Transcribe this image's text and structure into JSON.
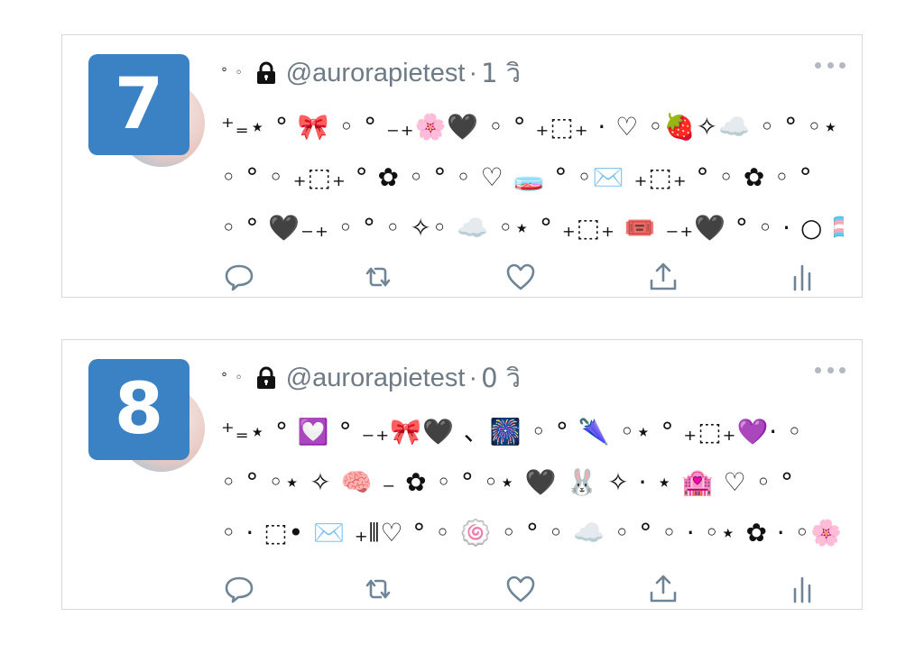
{
  "tweets": [
    {
      "rank": "7",
      "handle": "@aurorapietest",
      "separator": "·",
      "time": "1 วิ",
      "lines": [
        "⁺₌⋆ ° 🎀 ◦ ° ₋₊🌸🖤 ◦ ° ₊⬚₊ · ♡ ◦🍓✧☁️ ◦ ° ◦⋆",
        "◦ ° ◦ ₊⬚₊ ° ✿ ◦ ° ◦ ♡ 🧫 ° ◦✉️ ₊⬚₊ ° ◦ ✿ ◦ °",
        "◦ ° 🖤₋₊ ◦ ° ◦ ✧◦ ☁️ ◦⋆ ° ₊⬚₊ 🎟️ ₋₊🖤 ° ◦ · ○ 🏳️‍⚧️"
      ]
    },
    {
      "rank": "8",
      "handle": "@aurorapietest",
      "separator": "·",
      "time": "0 วิ",
      "lines": [
        "⁺₌⋆ ° 💟 ° ₋₊🎀🖤 、🎆 ◦ ° 🌂 ◦⋆ ° ₊⬚₊💜· ◦",
        "◦ ° ◦⋆ ✧ 🧠 ₋ ✿ ◦ ° ◦⋆ 🖤 🐰 ✧ · ⋆ 🏩 ♡ ◦ °",
        "◦ · ⬚• ✉️ ₊⫴♡ ° ◦ 🍥 ◦ ° ◦ ☁️ ◦ ° ◦ · ◦⋆ ✿ · ◦🌸 · ◦"
      ]
    }
  ],
  "header_deco": "° ◦",
  "icons": {
    "lock": "lock-icon",
    "more": "more-icon",
    "reply": "reply-icon",
    "retweet": "retweet-icon",
    "like": "heart-icon",
    "share": "share-icon",
    "stats": "stats-icon"
  },
  "colors": {
    "badge": "#3a82c4",
    "muted": "#6e7a85",
    "icon": "#6e8597",
    "border": "#d6d9dc"
  }
}
